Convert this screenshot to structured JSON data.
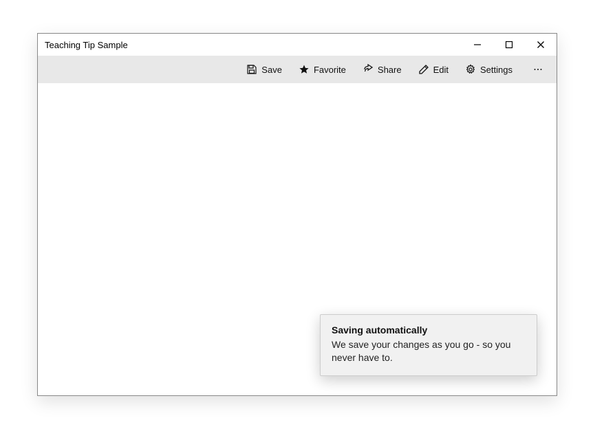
{
  "window": {
    "title": "Teaching Tip Sample"
  },
  "commandbar": {
    "save_label": "Save",
    "favorite_label": "Favorite",
    "share_label": "Share",
    "edit_label": "Edit",
    "settings_label": "Settings"
  },
  "teaching_tip": {
    "title": "Saving automatically",
    "body": "We save your changes as you go - so you never have to."
  }
}
